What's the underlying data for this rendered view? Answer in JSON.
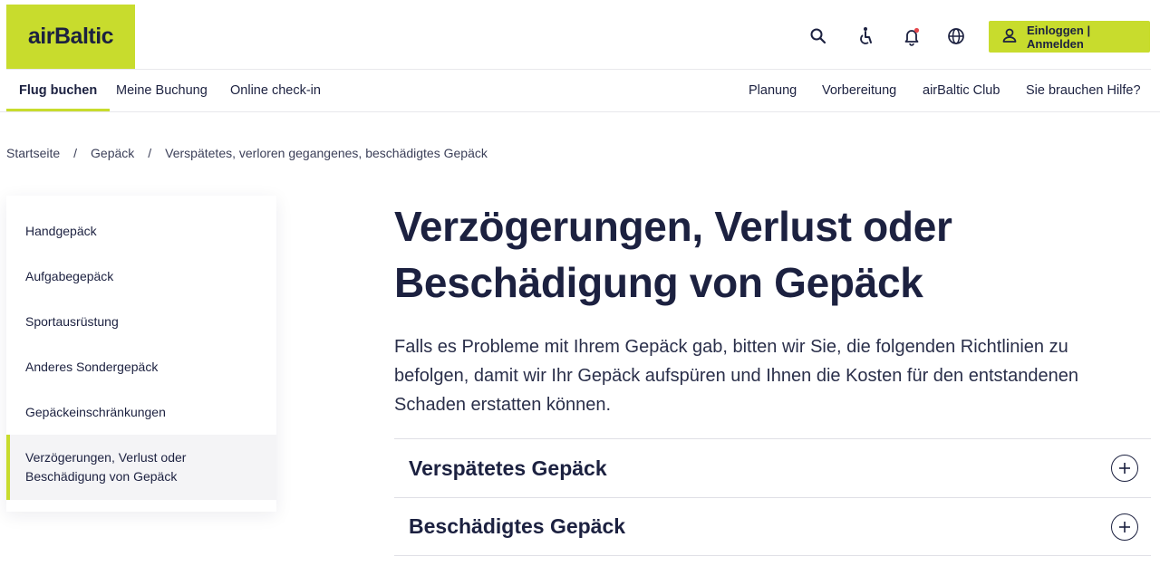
{
  "header": {
    "logo_text": "airBaltic",
    "login_label": "Einloggen | Anmelden",
    "icons": [
      "search-icon",
      "accessibility-icon",
      "bell-icon",
      "globe-icon",
      "user-icon"
    ]
  },
  "nav": {
    "left": [
      {
        "label": "Flug buchen",
        "active": true
      },
      {
        "label": "Meine Buchung"
      },
      {
        "label": "Online check-in"
      }
    ],
    "right": [
      {
        "label": "Planung"
      },
      {
        "label": "Vorbereitung"
      },
      {
        "label": "airBaltic Club"
      },
      {
        "label": "Sie brauchen Hilfe?"
      }
    ]
  },
  "breadcrumb": {
    "items": [
      "Startseite",
      "Gepäck",
      "Verspätetes, verloren gegangenes, beschädigtes Gepäck"
    ],
    "separator": "/"
  },
  "sidebar": {
    "items": [
      {
        "label": "Handgepäck"
      },
      {
        "label": "Aufgabegepäck"
      },
      {
        "label": "Sportausrüstung"
      },
      {
        "label": "Anderes Sondergepäck"
      },
      {
        "label": "Gepäckeinschränkungen"
      },
      {
        "label_line1": "Verzögerungen, Verlust oder",
        "label_line2": "Beschädigung von Gepäck",
        "active": true
      }
    ]
  },
  "main": {
    "title_line1": "Verzögerungen, Verlust oder",
    "title_line2": "Beschädigung von Gepäck",
    "intro": "Falls es Probleme mit Ihrem Gepäck gab, bitten wir Sie, die folgenden Richtlinien zu befolgen, damit wir Ihr Gepäck aufspüren und Ihnen die Kosten für den entstandenen Schaden erstatten können.",
    "accordion": [
      {
        "title": "Verspätetes Gepäck"
      },
      {
        "title": "Beschädigtes Gepäck"
      }
    ]
  },
  "colors": {
    "brand_lime": "#c8dc2d",
    "text_navy": "#1c2140",
    "notification_dot": "#e5484d"
  }
}
